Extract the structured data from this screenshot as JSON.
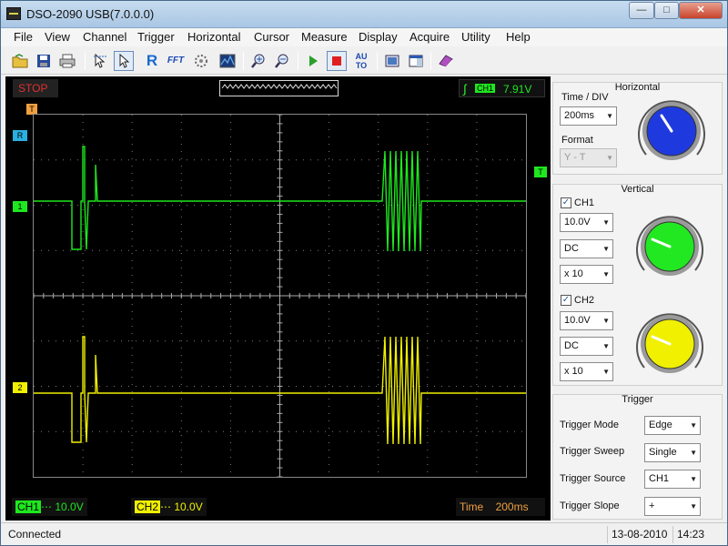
{
  "window": {
    "title": "DSO-2090 USB(7.0.0.0)"
  },
  "menu": [
    "File",
    "View",
    "Channel",
    "Trigger",
    "Horizontal",
    "Cursor",
    "Measure",
    "Display",
    "Acquire",
    "Utility",
    "Help"
  ],
  "toolbar_icons": [
    "open-folder-icon",
    "save-icon",
    "print-icon",
    "pointer-select-icon",
    "pointer-icon",
    "reference-icon",
    "fft-icon",
    "persistence-icon",
    "spectrum-icon",
    "zoom-in-icon",
    "zoom-out-icon",
    "run-icon",
    "stop-icon",
    "auto-icon",
    "snapshot-icon",
    "window-icon",
    "book-icon"
  ],
  "toolbar_text": {
    "reference": "R",
    "fft": "FFT",
    "auto": "AU\nTO"
  },
  "scope": {
    "run_state": "STOP",
    "trigger_channel": "CH1",
    "trigger_level": "7.91V",
    "markers": {
      "time": "T",
      "ref": "R",
      "trigger": "T",
      "ch1": "1",
      "ch2": "2"
    }
  },
  "bottom": {
    "ch1_label": "CH1",
    "ch1_value": "10.0V",
    "ch2_label": "CH2",
    "ch2_value": "10.0V",
    "time_label": "Time",
    "time_value": "200ms"
  },
  "horizontal": {
    "title": "Horizontal",
    "time_div_label": "Time / DIV",
    "time_div_value": "200ms",
    "format_label": "Format",
    "format_value": "Y - T",
    "knob_color": "#1e3adf"
  },
  "vertical": {
    "title": "Vertical",
    "ch1": {
      "label": "CH1",
      "volts": "10.0V",
      "coupling": "DC",
      "probe": "x 10",
      "knob_color": "#22e822"
    },
    "ch2": {
      "label": "CH2",
      "volts": "10.0V",
      "coupling": "DC",
      "probe": "x 10",
      "knob_color": "#f0f000"
    }
  },
  "trigger": {
    "title": "Trigger",
    "mode_label": "Trigger Mode",
    "mode_value": "Edge",
    "sweep_label": "Trigger Sweep",
    "sweep_value": "Single",
    "source_label": "Trigger Source",
    "source_value": "CH1",
    "slope_label": "Trigger Slope",
    "slope_value": "+"
  },
  "status": {
    "left": "Connected",
    "date": "13-08-2010",
    "time": "14:23"
  },
  "colors": {
    "ch1": "#1ee81e",
    "ch2": "#f0f000",
    "grid": "#7a7a7a",
    "stop": "#e03030",
    "time": "#f0a040"
  }
}
